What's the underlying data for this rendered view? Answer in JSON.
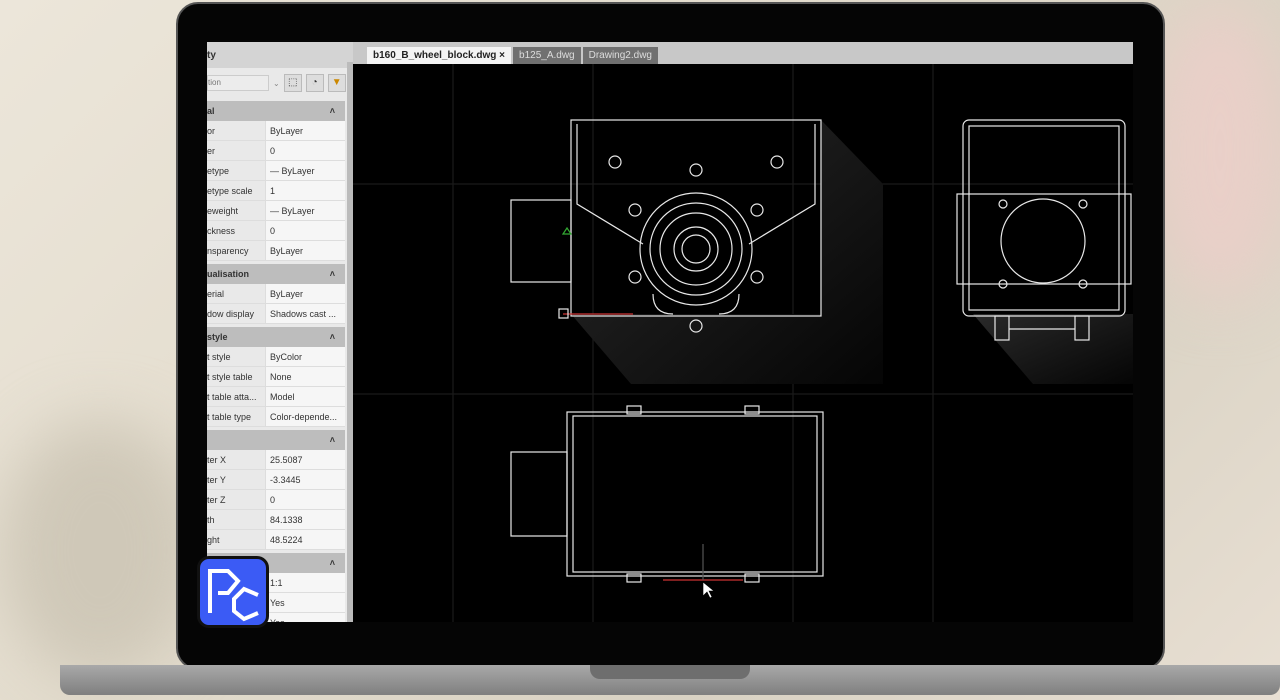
{
  "panel": {
    "title": "ty",
    "dropdown": "tion",
    "sections": [
      {
        "name": "al",
        "rows": [
          [
            "or",
            "ByLayer"
          ],
          [
            "er",
            "0"
          ],
          [
            "etype",
            "— ByLayer"
          ],
          [
            "etype scale",
            "1"
          ],
          [
            "eweight",
            "— ByLayer"
          ],
          [
            "ckness",
            "0"
          ],
          [
            "nsparency",
            "ByLayer"
          ]
        ]
      },
      {
        "name": "ualisation",
        "rows": [
          [
            "erial",
            "ByLayer"
          ],
          [
            "dow display",
            "Shadows cast ..."
          ]
        ]
      },
      {
        "name": "style",
        "rows": [
          [
            "t style",
            "ByColor"
          ],
          [
            "t style table",
            "None"
          ],
          [
            "t table atta...",
            "Model"
          ],
          [
            "t table type",
            "Color-depende..."
          ]
        ]
      },
      {
        "name": "",
        "rows": [
          [
            "ter X",
            "25.5087"
          ],
          [
            "ter Y",
            "-3.3445"
          ],
          [
            "ter Z",
            "0"
          ],
          [
            "th",
            "84.1338"
          ],
          [
            "ght",
            "48.5224"
          ]
        ]
      },
      {
        "name": "",
        "rows": [
          [
            "",
            "1:1"
          ],
          [
            "",
            "Yes"
          ],
          [
            "",
            "Yes"
          ]
        ]
      }
    ]
  },
  "tabs": [
    {
      "label": "b160_B_wheel_block.dwg",
      "close": "×"
    },
    {
      "label": "b125_A.dwg"
    },
    {
      "label": "Drawing2.dwg"
    }
  ],
  "logo": {
    "text": "PC"
  }
}
